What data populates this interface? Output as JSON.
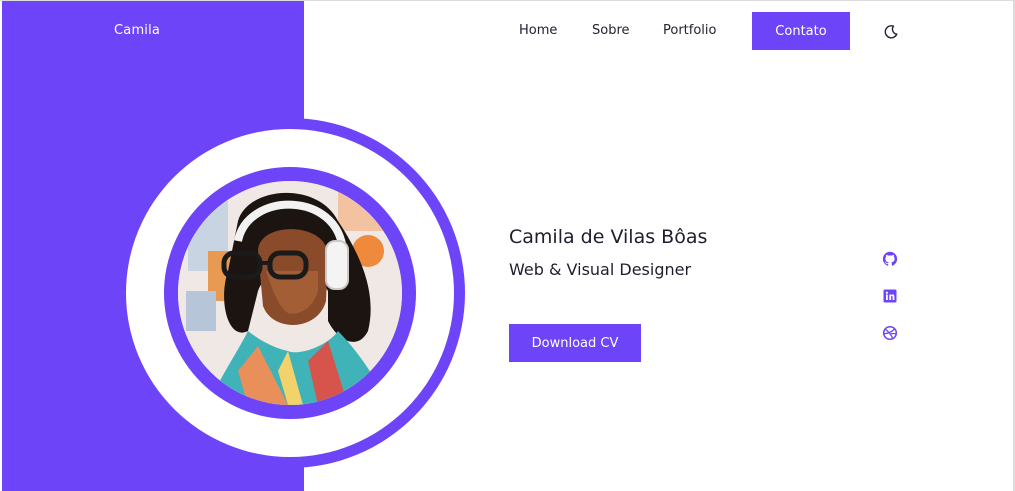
{
  "header": {
    "brand": "Camila",
    "nav": {
      "home": "Home",
      "sobre": "Sobre",
      "portfolio": "Portfolio",
      "contato": "Contato"
    },
    "theme_toggle_icon": "moon-icon"
  },
  "hero": {
    "name": "Camila de Vilas Bôas",
    "role": "Web & Visual Designer",
    "cta_label": "Download CV",
    "portrait_icon": "profile-portrait"
  },
  "social": [
    {
      "icon": "github-icon"
    },
    {
      "icon": "linkedin-icon"
    },
    {
      "icon": "dribbble-icon"
    }
  ],
  "colors": {
    "accent": "#6d44f7",
    "background": "#ffffff",
    "text": "#1e1e2e"
  }
}
